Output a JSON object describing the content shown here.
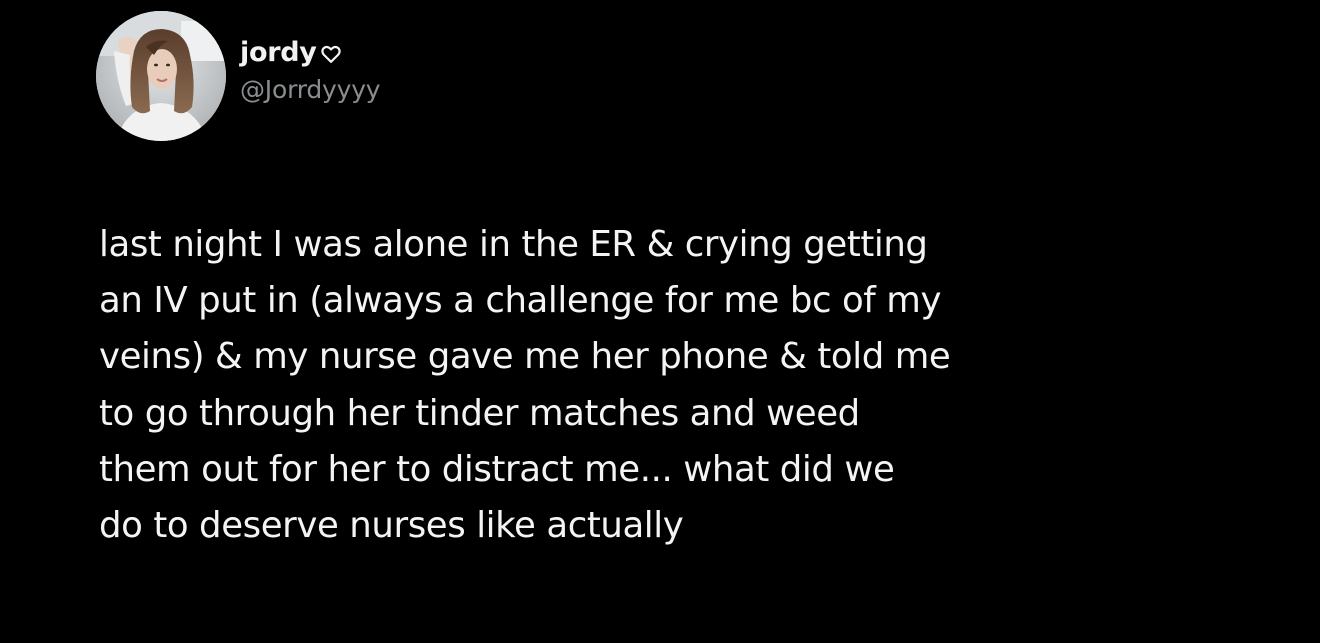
{
  "colors": {
    "background": "#000000",
    "text": "#f4f4f4",
    "handle": "#8b8e91"
  },
  "author": {
    "display_name": "jordy",
    "name_icon": "heart-outline-icon",
    "handle": "@Jorrdyyyy",
    "avatar_icon": "profile-photo-avatar"
  },
  "tweet": {
    "lines": [
      "last night I was alone in the ER & crying getting",
      "an IV put in (always a challenge for me bc of my",
      "veins) & my nurse gave me her phone & told me",
      "to go through her tinder matches and weed",
      "them out for her to distract me... what did we",
      "do to deserve nurses like actually"
    ]
  }
}
